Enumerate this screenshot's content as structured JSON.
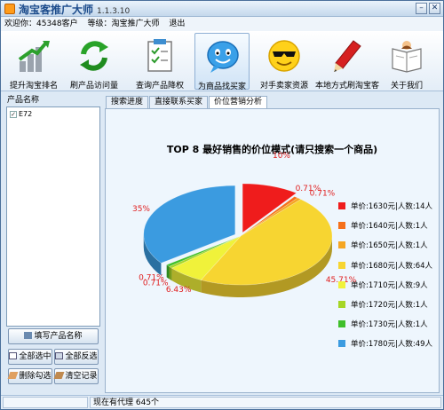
{
  "window": {
    "title": "淘宝客推广大师",
    "version": "1.1.3.10"
  },
  "info": {
    "welcome": "欢迎你：45348客户",
    "level": "等级：淘宝推广大师",
    "logout": "退出"
  },
  "toolbar": [
    {
      "label": "提升淘宝排名",
      "icon": "bar-chart-icon"
    },
    {
      "label": "刷产品访问量",
      "icon": "recycle-arrows-icon"
    },
    {
      "label": "查询产品降权",
      "icon": "checklist-icon"
    },
    {
      "label": "为商品找买家",
      "icon": "chat-bubble-face-icon",
      "active": true
    },
    {
      "label": "对手卖家资源",
      "icon": "sunglasses-face-icon"
    },
    {
      "label": "本地方式刷淘宝客",
      "icon": "pen-icon"
    },
    {
      "label": "关于我们",
      "icon": "book-reader-icon"
    }
  ],
  "left_panel": {
    "header": "产品名称",
    "items": [
      {
        "label": "E72",
        "checked": true
      }
    ],
    "buttons": {
      "fill_name": "填写产品名称",
      "select_all": "全部选中",
      "invert": "全部反选",
      "delete_checked": "删除勾选",
      "clear_records": "清空记录"
    }
  },
  "tabs": [
    {
      "label": "搜索进度"
    },
    {
      "label": "直接联系买家"
    },
    {
      "label": "价位营销分析",
      "active": true
    }
  ],
  "status": {
    "proxy": "现在有代理 645个"
  },
  "chart_data": {
    "type": "pie",
    "title": "TOP 8 最好销售的价位模式(请只搜索一个商品)",
    "slices": [
      {
        "name": "单价:1630元|人数:14人",
        "value": 14,
        "pct_label": "10%",
        "color": "#ef1c1c"
      },
      {
        "name": "单价:1640元|人数:1人",
        "value": 1,
        "pct_label": "0.71%",
        "color": "#f5701a"
      },
      {
        "name": "单价:1650元|人数:1人",
        "value": 1,
        "pct_label": "0.71%",
        "color": "#f5a623"
      },
      {
        "name": "单价:1680元|人数:64人",
        "value": 64,
        "pct_label": "45.71%",
        "color": "#f7d531"
      },
      {
        "name": "单价:1710元|人数:9人",
        "value": 9,
        "pct_label": "6.43%",
        "color": "#f0f23a"
      },
      {
        "name": "单价:1720元|人数:1人",
        "value": 1,
        "pct_label": "0.71%",
        "color": "#a5d625"
      },
      {
        "name": "单价:1730元|人数:1人",
        "value": 1,
        "pct_label": "0.71%",
        "color": "#3fbf2a"
      },
      {
        "name": "单价:1780元|人数:49人",
        "value": 49,
        "pct_label": "35%",
        "color": "#3b9be0"
      }
    ]
  }
}
